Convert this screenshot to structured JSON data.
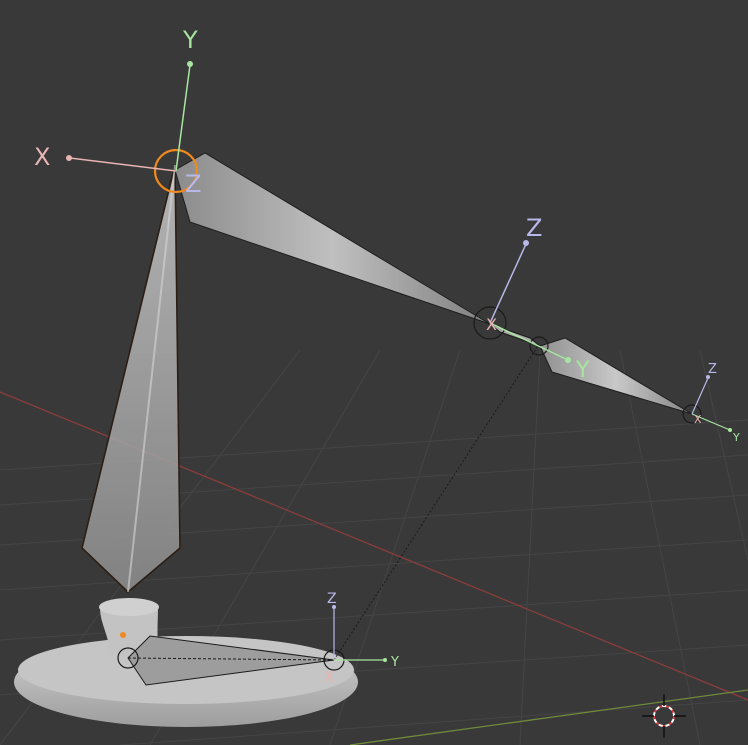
{
  "colors": {
    "background": "#393939",
    "grid": "#454545",
    "x_axis_line": "#8a3d3d",
    "y_axis_line": "#6e8a3a",
    "gizmo_x": "#e8b4b4",
    "gizmo_y": "#a7e6a0",
    "gizmo_z": "#b8b8ea",
    "bone": "#b9b9b9",
    "selected_bone_outline": "#2b1a0e",
    "active_joint": "#f08a1e",
    "base_mesh": "#bdbdbd"
  },
  "gizmos": {
    "top": {
      "x": "X",
      "y": "Y",
      "z": "Z"
    },
    "elbow": {
      "x": "X",
      "y": "Y",
      "z": "Z"
    },
    "tip": {
      "x": "X",
      "y": "Y",
      "z": "Z"
    },
    "base_joint": {
      "x": "X",
      "y": "Y",
      "z": "Z"
    }
  },
  "icons": {
    "cursor": "3d-cursor-icon"
  }
}
